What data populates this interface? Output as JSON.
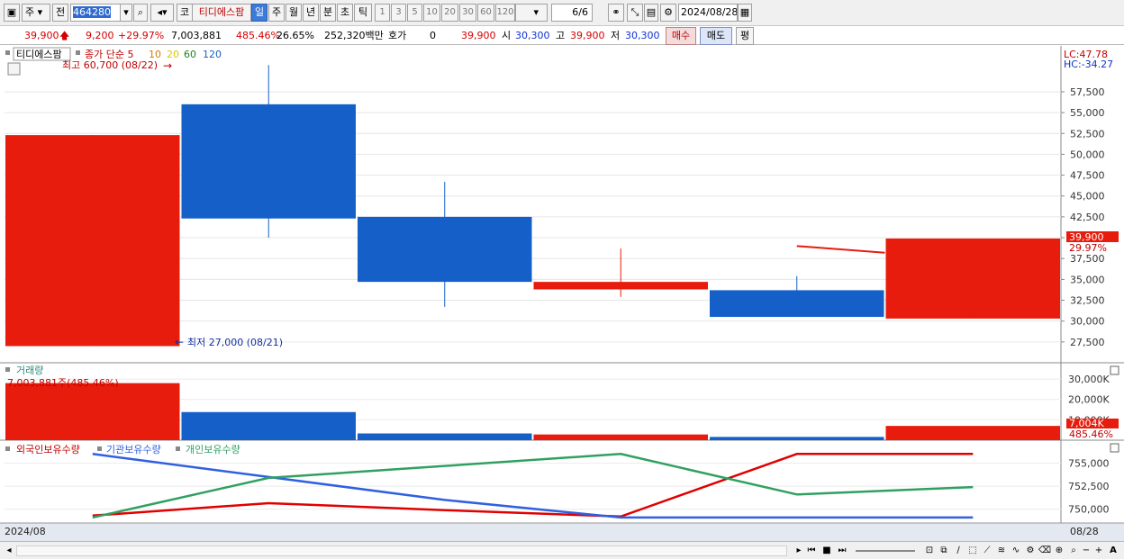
{
  "toolbar": {
    "market": "주",
    "prev_label": "전",
    "code": "464280",
    "name_prefix": "코",
    "name": "티디에스팜",
    "periods": [
      "일",
      "주",
      "월",
      "년",
      "분",
      "초",
      "틱"
    ],
    "intervals": [
      "1",
      "3",
      "5",
      "10",
      "20",
      "30",
      "60",
      "120"
    ],
    "page": "6/6",
    "date": "2024/08/28"
  },
  "quote": {
    "price": "39,900",
    "change": "9,200",
    "change_pct": "+29.97%",
    "volume": "7,003,881",
    "vol_ratio": "485.46%",
    "turnover": "26.65%",
    "amount": "252,320백만",
    "hoga_label": "호가",
    "hoga_value": "0",
    "hoga_price": "39,900",
    "open_label": "시",
    "open": "30,300",
    "high_label": "고",
    "high": "39,900",
    "low_label": "저",
    "low": "30,300",
    "buy_label": "매수",
    "sell_label": "매도",
    "avg_label": "평"
  },
  "chart_data": {
    "type": "candlestick",
    "price_panel": {
      "title": "티디에스팜",
      "ma_label": "종가 단순 5",
      "ma_periods": [
        "10",
        "20",
        "60",
        "120"
      ],
      "ma_colors": [
        "#d08000",
        "#d8c800",
        "#208020",
        "#2060c0"
      ],
      "high_note": "최고 60,700 (08/22)",
      "low_note": "최저 27,000 (08/21)",
      "lc": "LC:47.78",
      "hc": "HC:-34.27",
      "current_price_tag": "39,900",
      "current_pct_tag": "29.97%",
      "y_ticks": [
        57500,
        55000,
        52500,
        50000,
        47500,
        45000,
        42500,
        40000,
        37500,
        35000,
        32500,
        30000,
        27500
      ],
      "y_tick_labels": [
        "57,500",
        "55,000",
        "52,500",
        "50,000",
        "47,500",
        "45,000",
        "42,500",
        "40,000",
        "37,500",
        "35,000",
        "32,500",
        "30,000",
        "27,500"
      ],
      "ylim": [
        25000,
        63000
      ],
      "candles": [
        {
          "open": 27000,
          "close": 52300,
          "high": 52300,
          "low": 27000,
          "color": "#e81c0c"
        },
        {
          "open": 56000,
          "close": 42300,
          "high": 60700,
          "low": 40000,
          "color": "#1560c8"
        },
        {
          "open": 42500,
          "close": 34700,
          "high": 46700,
          "low": 31700,
          "color": "#1560c8"
        },
        {
          "open": 34700,
          "close": 33800,
          "high": 38700,
          "low": 32900,
          "color": "#e81c0c"
        },
        {
          "open": 33700,
          "close": 30500,
          "high": 35400,
          "low": 30500,
          "color": "#1560c8"
        },
        {
          "open": 30300,
          "close": 39900,
          "high": 39900,
          "low": 30300,
          "color": "#e81c0c"
        }
      ],
      "ma5": [
        {
          "i": 4.5,
          "v": 39000
        },
        {
          "i": 5.0,
          "v": 38200
        }
      ]
    },
    "volume_panel": {
      "title": "거래량",
      "readout": "7,003,881주(485.46%)",
      "tag_value": "7,004K",
      "tag_pct": "485.46%",
      "y_ticks": [
        30000,
        20000,
        10000
      ],
      "y_tick_labels": [
        "30,000K",
        "20,000K",
        "10,000K"
      ],
      "ylim": [
        0,
        38000
      ],
      "values": [
        28000,
        13800,
        3300,
        2800,
        1600,
        7004
      ]
    },
    "holding_panel": {
      "series_names": [
        "외국인보유수량",
        "기관보유수량",
        "개인보유수량"
      ],
      "colors": [
        "#e00000",
        "#3060e0",
        "#30a060"
      ],
      "y_ticks": [
        755000,
        752500,
        750000
      ],
      "y_tick_labels": [
        "755,000",
        "752,500",
        "750,000"
      ],
      "ylim": [
        748500,
        757500
      ],
      "series": [
        {
          "name": "외국인보유수량",
          "values": [
            749300,
            750650,
            749900,
            749200,
            756000,
            756000
          ]
        },
        {
          "name": "기관보유수량",
          "values": [
            756000,
            753500,
            751000,
            749100,
            749100,
            749100
          ]
        },
        {
          "name": "개인보유수량",
          "values": [
            749100,
            753400,
            754700,
            756000,
            751600,
            752400
          ]
        }
      ]
    },
    "x_start_label": "2024/08",
    "x_end_label": "08/28"
  }
}
